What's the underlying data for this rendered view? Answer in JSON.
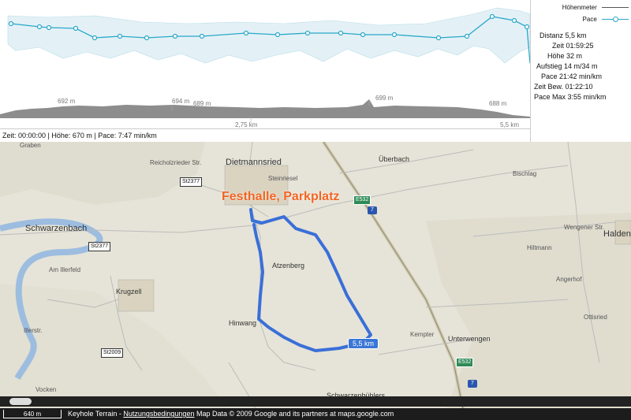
{
  "chart": {
    "elev_labels": [
      "692 m",
      "694 m",
      "689 m",
      "699 m",
      "688 m"
    ],
    "dist_labels": [
      "2,75 km",
      "5,5 km"
    ]
  },
  "legend": {
    "elevation": "Höhenmeter",
    "pace": "Pace"
  },
  "status_text": "Zeit: 00:00:00 | Höhe: 670 m | Pace: 7:47 min/km",
  "stats": [
    "Distanz 5,5 km",
    "Zeit 01:59:25",
    "Höhe 32 m",
    "Aufstieg 14 m/34 m",
    "Pace 21:42 min/km",
    "Zeit Bew. 01:22:10",
    "Pace Max 3:55 min/km"
  ],
  "map": {
    "start_label": "Festhalle, Parkplatz",
    "distance_tag": "5,5 km",
    "towns": [
      "Dietmannsried",
      "Schwarzenbach",
      "Krugzell",
      "Haldenw",
      "Überbach",
      "Unterwengen",
      "Schwarzenbühlers",
      "Hinwang",
      "Atzenberg"
    ],
    "small_labels": [
      "Steinriesel",
      "Reicholzrieder Str.",
      "Wengener Str.",
      "Vocken",
      "Graben",
      "Am Illerfeld",
      "Illerstr.",
      "Hiltmann",
      "Ottisried",
      "Angerhof",
      "Kempter",
      "Bischlag"
    ],
    "road_badges": [
      "St2377",
      "St2377",
      "St2009"
    ],
    "e_shields": [
      "E532",
      "E532"
    ],
    "a_shields": [
      "7",
      "7"
    ]
  },
  "footer": {
    "scale": "640 m",
    "text_prefix": "Keyhole Terrain - ",
    "terms_link": "Nutzungsbedingungen",
    "text_suffix": " Map Data © 2009 Google and its partners at maps.google.com"
  },
  "colors": {
    "route": "#3a6fd8",
    "pace_line": "#2aa7c9",
    "start_label": "#f26522",
    "river": "#9dbde0"
  }
}
